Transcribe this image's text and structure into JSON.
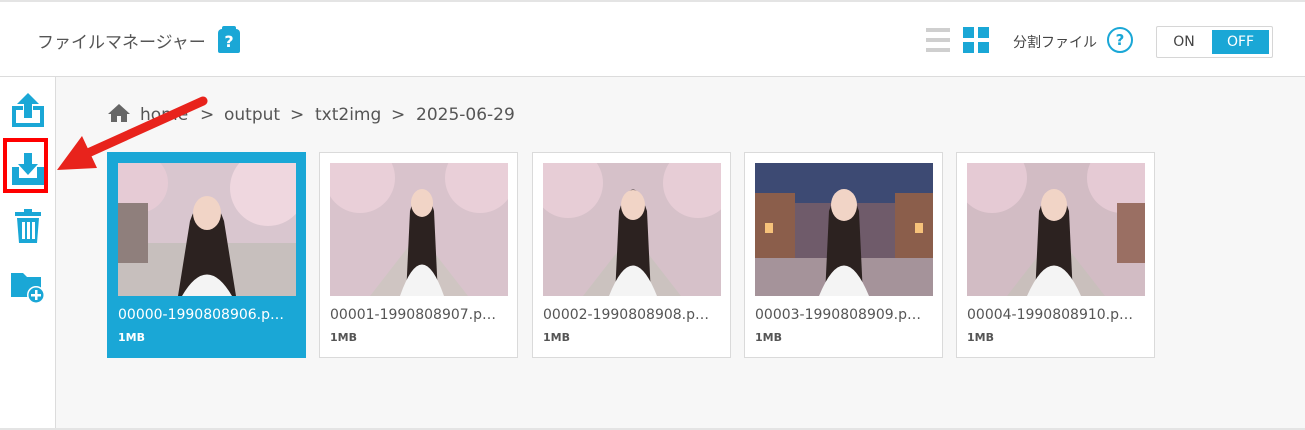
{
  "header": {
    "title": "ファイルマネージャー",
    "help_glyph": "?",
    "split_label": "分割ファイル",
    "split_help_glyph": "?",
    "toggle_on": "ON",
    "toggle_off": "OFF",
    "toggle_state": "OFF",
    "view_mode": "grid"
  },
  "sidebar": {
    "buttons": [
      {
        "name": "upload",
        "icon": "upload-icon"
      },
      {
        "name": "download",
        "icon": "download-icon",
        "highlighted": true
      },
      {
        "name": "delete",
        "icon": "trash-icon"
      },
      {
        "name": "new-folder",
        "icon": "folder-plus-icon"
      }
    ]
  },
  "breadcrumb": {
    "items": [
      "home",
      "output",
      "txt2img",
      "2025-06-29"
    ],
    "separator": ">"
  },
  "files": [
    {
      "name": "00000-1990808906.p…",
      "size": "1MB",
      "selected": true
    },
    {
      "name": "00001-1990808907.p…",
      "size": "1MB",
      "selected": false
    },
    {
      "name": "00002-1990808908.p…",
      "size": "1MB",
      "selected": false
    },
    {
      "name": "00003-1990808909.p…",
      "size": "1MB",
      "selected": false
    },
    {
      "name": "00004-1990808910.p…",
      "size": "1MB",
      "selected": false
    }
  ],
  "colors": {
    "accent": "#1aa7d6",
    "highlight": "#ff0000",
    "background": "#f7f7f7"
  }
}
